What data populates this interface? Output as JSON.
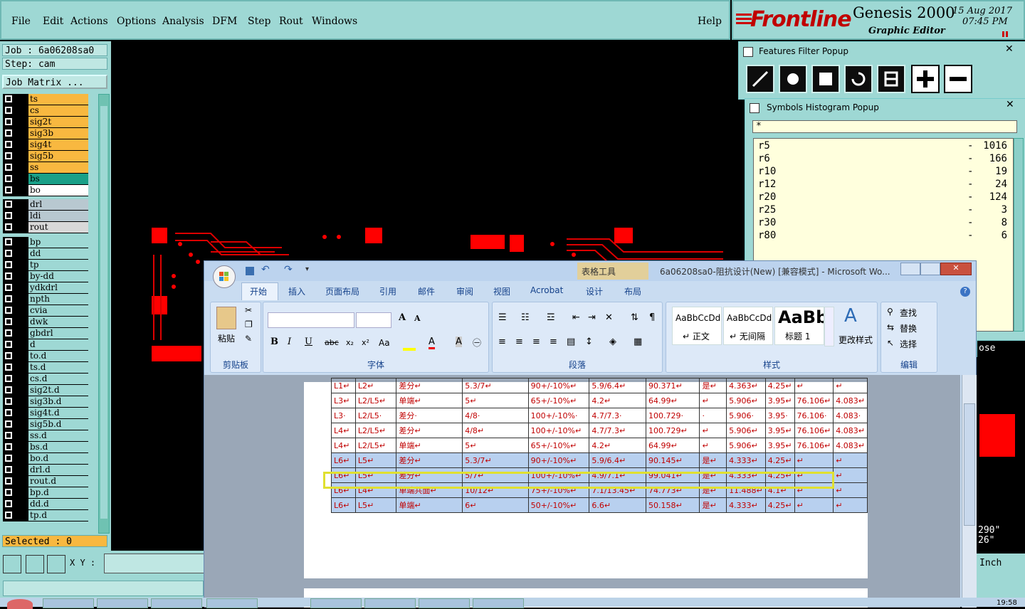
{
  "menu": {
    "items": [
      "File",
      "Edit",
      "Actions",
      "Options",
      "Analysis",
      "DFM",
      "Step",
      "Rout",
      "Windows"
    ],
    "help": "Help"
  },
  "logo": {
    "brand": "Frontline",
    "product": "Genesis 2000",
    "subtitle": "Graphic Editor",
    "date": "15 Aug 2017",
    "time": "07:45 PM"
  },
  "job": {
    "job_label": "Job  :  6a06208sa0",
    "step_label": "Step:  cam",
    "matrix_button": "Job Matrix ...",
    "selected": "Selected : 0",
    "xy_label": "X Y :"
  },
  "layers_group1": [
    {
      "name": "ts",
      "color": "#f8b840"
    },
    {
      "name": "cs",
      "color": "#f8b840"
    },
    {
      "name": "sig2t",
      "color": "#f8b840"
    },
    {
      "name": "sig3b",
      "color": "#f8b840"
    },
    {
      "name": "sig4t",
      "color": "#f8b840"
    },
    {
      "name": "sig5b",
      "color": "#f8b840"
    },
    {
      "name": "ss",
      "color": "#f8b840"
    },
    {
      "name": "bs",
      "color": "#1aa088"
    },
    {
      "name": "bo",
      "color": "#ffffff"
    }
  ],
  "layers_group2": [
    {
      "name": "drl",
      "color": "#b8c8d0"
    },
    {
      "name": "ldi",
      "color": "#b8c8d0"
    },
    {
      "name": "rout",
      "color": "#d8d8d8"
    }
  ],
  "layers_group3": [
    "bp",
    "dd",
    "tp",
    "by-dd",
    "ydkdrl",
    "npth",
    "cvia",
    "dwk",
    "gbdrl",
    "d",
    "to.d",
    "ts.d",
    "cs.d",
    "sig2t.d",
    "sig3b.d",
    "sig4t.d",
    "sig5b.d",
    "ss.d",
    "bs.d",
    "bo.d",
    "drl.d",
    "rout.d",
    "bp.d",
    "dd.d",
    "tp.d"
  ],
  "features_popup": {
    "title": "Features Filter Popup",
    "tools": [
      "line-icon",
      "pad-icon",
      "surface-icon",
      "arc-icon",
      "text-icon",
      "plus-icon",
      "minus-icon"
    ]
  },
  "histogram": {
    "title": "Symbols Histogram Popup",
    "filter": "*",
    "rows": [
      {
        "sym": "r5",
        "count": "1016"
      },
      {
        "sym": "r6",
        "count": "166"
      },
      {
        "sym": "r10",
        "count": "19"
      },
      {
        "sym": "r12",
        "count": "24"
      },
      {
        "sym": "r20",
        "count": "124"
      },
      {
        "sym": "r25",
        "count": "3"
      },
      {
        "sym": "r30",
        "count": "8"
      },
      {
        "sym": "r80",
        "count": "6"
      }
    ],
    "dash": "-"
  },
  "right_fragments": {
    "close": "ose",
    "coord1": "290\"",
    "coord2": "26\"",
    "units": "Inch"
  },
  "word": {
    "tools_tab": "表格工具",
    "title": "6a06208sa0-阻抗设计(New) [兼容模式] - Microsoft Wo...",
    "tabs": [
      "开始",
      "插入",
      "页面布局",
      "引用",
      "邮件",
      "审阅",
      "视图",
      "Acrobat",
      "设计",
      "布局"
    ],
    "groups": {
      "clipboard": "剪贴板",
      "paste": "粘贴",
      "font": "字体",
      "paragraph": "段落",
      "styles": "样式",
      "editing": "编辑"
    },
    "styles": [
      {
        "sample": "AaBbCcDd",
        "name": "↵ 正文"
      },
      {
        "sample": "AaBbCcDd",
        "name": "↵ 无间隔"
      },
      {
        "sample": "AaBb",
        "name": "标题 1"
      }
    ],
    "change_styles": "更改样式",
    "find": "查找",
    "replace": "替换",
    "select": "选择",
    "table_rows": [
      [
        "L1↵",
        "L2↵",
        "差分↵",
        "5.3/7↵",
        "90+/-10%↵",
        "5.9/6.4↵",
        "90.371↵",
        "是↵",
        "4.363↵",
        "4.25↵",
        "↵",
        "↵"
      ],
      [
        "L3↵",
        "L2/L5↵",
        "单端↵",
        "5↵",
        "65+/-10%↵",
        "4.2↵",
        "64.99↵",
        "↵",
        "5.906↵",
        "3.95↵",
        "76.106↵",
        "4.083↵"
      ],
      [
        "L3·",
        "L2/L5·",
        "差分·",
        "4/8·",
        "100+/-10%·",
        "4.7/7.3·",
        "100.729·",
        "·",
        "5.906·",
        "3.95·",
        "76.106·",
        "4.083·"
      ],
      [
        "L4↵",
        "L2/L5↵",
        "差分↵",
        "4/8↵",
        "100+/-10%↵",
        "4.7/7.3↵",
        "100.729↵",
        "↵",
        "5.906↵",
        "3.95↵",
        "76.106↵",
        "4.083↵"
      ],
      [
        "L4↵",
        "L2/L5↵",
        "单端↵",
        "5↵",
        "65+/-10%↵",
        "4.2↵",
        "64.99↵",
        "↵",
        "5.906↵",
        "3.95↵",
        "76.106↵",
        "4.083↵"
      ],
      [
        "L6↵",
        "L5↵",
        "差分↵",
        "5.3/7↵",
        "90+/-10%↵",
        "5.9/6.4↵",
        "90.145↵",
        "是↵",
        "4.333↵",
        "4.25↵",
        "↵",
        "↵"
      ],
      [
        "L6↵",
        "L5↵",
        "差分↵",
        "5/7↵",
        "100+/-10%↵",
        "4.9/7.1↵",
        "99.041↵",
        "是↵",
        "4.333↵",
        "4.25↵",
        "↵",
        "↵"
      ],
      [
        "L6↵",
        "L4↵",
        "单端共面↵",
        "10/12↵",
        "75+/-10%↵",
        "7.1/13.45↵",
        "74.773↵",
        "是↵",
        "11.488↵",
        "4.1↵",
        "↵",
        "↵"
      ],
      [
        "L6↵",
        "L5↵",
        "单端↵",
        "6↵",
        "50+/-10%↵",
        "6.6↵",
        "50.158↵",
        "是↵",
        "4.333↵",
        "4.25↵",
        "↵",
        "↵"
      ]
    ]
  },
  "taskbar": {
    "clock": "19:58"
  }
}
